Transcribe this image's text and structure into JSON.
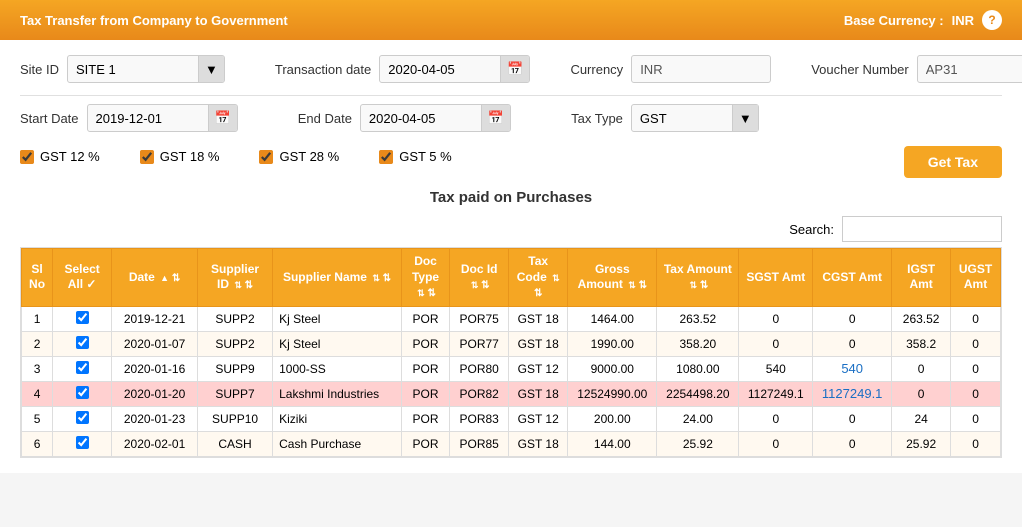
{
  "header": {
    "title": "Tax Transfer from Company to Government",
    "base_currency_label": "Base Currency :",
    "base_currency_value": "INR"
  },
  "form": {
    "site_id_label": "Site ID",
    "site_id_value": "SITE 1",
    "transaction_date_label": "Transaction date",
    "transaction_date_value": "2020-04-05",
    "currency_label": "Currency",
    "currency_value": "INR",
    "voucher_number_label": "Voucher Number",
    "voucher_number_value": "AP31",
    "start_date_label": "Start Date",
    "start_date_value": "2019-12-01",
    "end_date_label": "End Date",
    "end_date_value": "2020-04-05",
    "tax_type_label": "Tax Type",
    "tax_type_value": "GST",
    "gst12_label": "GST 12 %",
    "gst18_label": "GST 18 %",
    "gst28_label": "GST 28 %",
    "gst5_label": "GST 5 %",
    "get_tax_btn": "Get Tax"
  },
  "table": {
    "title": "Tax paid on Purchases",
    "search_label": "Search:",
    "columns": [
      "Sl No",
      "Select All",
      "Date",
      "Supplier ID",
      "Supplier Name",
      "Doc Type",
      "Doc Id",
      "Tax Code",
      "Gross Amount",
      "Tax Amount",
      "SGST Amt",
      "CGST Amt",
      "IGST Amt",
      "UGST Amt"
    ],
    "rows": [
      {
        "sl": "1",
        "checked": true,
        "date": "2019-12-21",
        "supplier_id": "SUPP2",
        "supplier_name": "Kj Steel",
        "doc_type": "POR",
        "doc_id": "POR75",
        "tax_code": "GST 18",
        "gross_amount": "1464.00",
        "tax_amount": "263.52",
        "sgst": "0",
        "cgst": "0",
        "igst": "263.52",
        "ugst": "0",
        "highlight": false
      },
      {
        "sl": "2",
        "checked": true,
        "date": "2020-01-07",
        "supplier_id": "SUPP2",
        "supplier_name": "Kj Steel",
        "doc_type": "POR",
        "doc_id": "POR77",
        "tax_code": "GST 18",
        "gross_amount": "1990.00",
        "tax_amount": "358.20",
        "sgst": "0",
        "cgst": "0",
        "igst": "358.2",
        "ugst": "0",
        "highlight": false
      },
      {
        "sl": "3",
        "checked": true,
        "date": "2020-01-16",
        "supplier_id": "SUPP9",
        "supplier_name": "1000-SS",
        "doc_type": "POR",
        "doc_id": "POR80",
        "tax_code": "GST 12",
        "gross_amount": "9000.00",
        "tax_amount": "1080.00",
        "sgst": "540",
        "cgst": "540",
        "igst": "0",
        "ugst": "0",
        "highlight": false
      },
      {
        "sl": "4",
        "checked": true,
        "date": "2020-01-20",
        "supplier_id": "SUPP7",
        "supplier_name": "Lakshmi Industries",
        "doc_type": "POR",
        "doc_id": "POR82",
        "tax_code": "GST 18",
        "gross_amount": "12524990.00",
        "tax_amount": "2254498.20",
        "sgst": "1127249.1",
        "cgst": "1127249.1",
        "igst": "0",
        "ugst": "0",
        "highlight": true
      },
      {
        "sl": "5",
        "checked": true,
        "date": "2020-01-23",
        "supplier_id": "SUPP10",
        "supplier_name": "Kiziki",
        "doc_type": "POR",
        "doc_id": "POR83",
        "tax_code": "GST 12",
        "gross_amount": "200.00",
        "tax_amount": "24.00",
        "sgst": "0",
        "cgst": "0",
        "igst": "24",
        "ugst": "0",
        "highlight": false
      },
      {
        "sl": "6",
        "checked": true,
        "date": "2020-02-01",
        "supplier_id": "CASH",
        "supplier_name": "Cash Purchase",
        "doc_type": "POR",
        "doc_id": "POR85",
        "tax_code": "GST 18",
        "gross_amount": "144.00",
        "tax_amount": "25.92",
        "sgst": "0",
        "cgst": "0",
        "igst": "25.92",
        "ugst": "0",
        "highlight": false
      }
    ]
  }
}
